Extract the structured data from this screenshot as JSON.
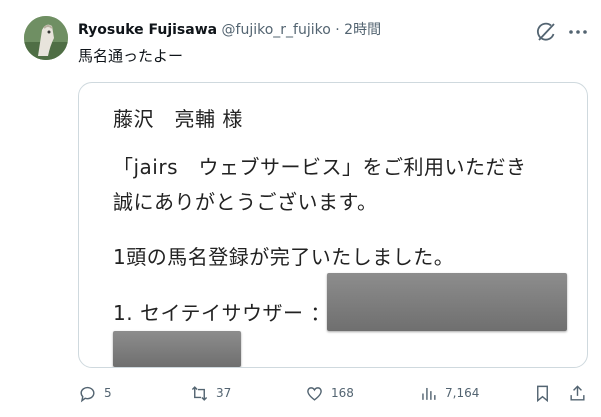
{
  "tweet": {
    "author_name": "Ryosuke Fujisawa",
    "handle": "@fujiko_r_fujiko",
    "separator": "·",
    "time": "2時間",
    "text": "馬名通ったよー"
  },
  "document": {
    "addressee": "藤沢　亮輔 様",
    "line1": "「jairs　ウェブサービス」をご利用いただき",
    "line2": "誠にありがとうございます。",
    "line3": "1頭の馬名登録が完了いたしました。",
    "line4": "1. セイテイサウザー ："
  },
  "actions": {
    "replies": "5",
    "reposts": "37",
    "likes": "168",
    "views": "7,164"
  },
  "icons": [
    "grok-icon",
    "more-icon",
    "reply-icon",
    "repost-icon",
    "like-icon",
    "views-icon",
    "bookmark-icon",
    "share-icon"
  ]
}
